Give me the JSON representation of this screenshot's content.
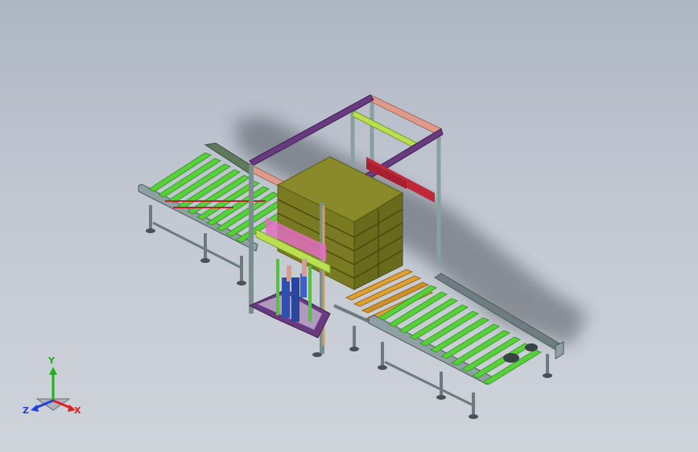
{
  "triad": {
    "x_label": "X",
    "y_label": "Y",
    "z_label": "Z",
    "x_color": "#e02020",
    "y_color": "#20b020",
    "z_color": "#2040e0"
  },
  "colors": {
    "background_top": "#aeb6c4",
    "background_bottom": "#cfd3da",
    "roller_green": "#57d13a",
    "frame_gray": "#7f8f93",
    "load_olive": "#8a8a2a",
    "roller_orange": "#e0a030",
    "frame_purple": "#7a3d8a",
    "frame_pink": "#e09a8a",
    "accent_red": "#d02838",
    "cylinder_blue": "#2c4fb0"
  }
}
